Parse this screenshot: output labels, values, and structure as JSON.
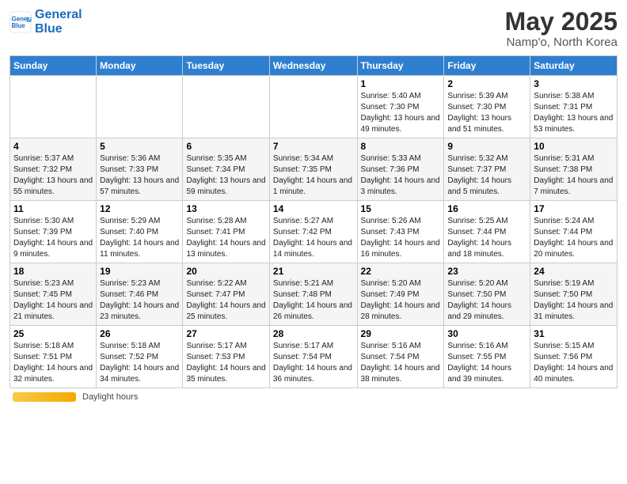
{
  "header": {
    "logo_line1": "General",
    "logo_line2": "Blue",
    "title": "May 2025",
    "subtitle": "Namp'o, North Korea"
  },
  "days_of_week": [
    "Sunday",
    "Monday",
    "Tuesday",
    "Wednesday",
    "Thursday",
    "Friday",
    "Saturday"
  ],
  "weeks": [
    [
      {
        "day": "",
        "info": ""
      },
      {
        "day": "",
        "info": ""
      },
      {
        "day": "",
        "info": ""
      },
      {
        "day": "",
        "info": ""
      },
      {
        "day": "1",
        "info": "Sunrise: 5:40 AM\nSunset: 7:30 PM\nDaylight: 13 hours and 49 minutes."
      },
      {
        "day": "2",
        "info": "Sunrise: 5:39 AM\nSunset: 7:30 PM\nDaylight: 13 hours and 51 minutes."
      },
      {
        "day": "3",
        "info": "Sunrise: 5:38 AM\nSunset: 7:31 PM\nDaylight: 13 hours and 53 minutes."
      }
    ],
    [
      {
        "day": "4",
        "info": "Sunrise: 5:37 AM\nSunset: 7:32 PM\nDaylight: 13 hours and 55 minutes."
      },
      {
        "day": "5",
        "info": "Sunrise: 5:36 AM\nSunset: 7:33 PM\nDaylight: 13 hours and 57 minutes."
      },
      {
        "day": "6",
        "info": "Sunrise: 5:35 AM\nSunset: 7:34 PM\nDaylight: 13 hours and 59 minutes."
      },
      {
        "day": "7",
        "info": "Sunrise: 5:34 AM\nSunset: 7:35 PM\nDaylight: 14 hours and 1 minute."
      },
      {
        "day": "8",
        "info": "Sunrise: 5:33 AM\nSunset: 7:36 PM\nDaylight: 14 hours and 3 minutes."
      },
      {
        "day": "9",
        "info": "Sunrise: 5:32 AM\nSunset: 7:37 PM\nDaylight: 14 hours and 5 minutes."
      },
      {
        "day": "10",
        "info": "Sunrise: 5:31 AM\nSunset: 7:38 PM\nDaylight: 14 hours and 7 minutes."
      }
    ],
    [
      {
        "day": "11",
        "info": "Sunrise: 5:30 AM\nSunset: 7:39 PM\nDaylight: 14 hours and 9 minutes."
      },
      {
        "day": "12",
        "info": "Sunrise: 5:29 AM\nSunset: 7:40 PM\nDaylight: 14 hours and 11 minutes."
      },
      {
        "day": "13",
        "info": "Sunrise: 5:28 AM\nSunset: 7:41 PM\nDaylight: 14 hours and 13 minutes."
      },
      {
        "day": "14",
        "info": "Sunrise: 5:27 AM\nSunset: 7:42 PM\nDaylight: 14 hours and 14 minutes."
      },
      {
        "day": "15",
        "info": "Sunrise: 5:26 AM\nSunset: 7:43 PM\nDaylight: 14 hours and 16 minutes."
      },
      {
        "day": "16",
        "info": "Sunrise: 5:25 AM\nSunset: 7:44 PM\nDaylight: 14 hours and 18 minutes."
      },
      {
        "day": "17",
        "info": "Sunrise: 5:24 AM\nSunset: 7:44 PM\nDaylight: 14 hours and 20 minutes."
      }
    ],
    [
      {
        "day": "18",
        "info": "Sunrise: 5:23 AM\nSunset: 7:45 PM\nDaylight: 14 hours and 21 minutes."
      },
      {
        "day": "19",
        "info": "Sunrise: 5:23 AM\nSunset: 7:46 PM\nDaylight: 14 hours and 23 minutes."
      },
      {
        "day": "20",
        "info": "Sunrise: 5:22 AM\nSunset: 7:47 PM\nDaylight: 14 hours and 25 minutes."
      },
      {
        "day": "21",
        "info": "Sunrise: 5:21 AM\nSunset: 7:48 PM\nDaylight: 14 hours and 26 minutes."
      },
      {
        "day": "22",
        "info": "Sunrise: 5:20 AM\nSunset: 7:49 PM\nDaylight: 14 hours and 28 minutes."
      },
      {
        "day": "23",
        "info": "Sunrise: 5:20 AM\nSunset: 7:50 PM\nDaylight: 14 hours and 29 minutes."
      },
      {
        "day": "24",
        "info": "Sunrise: 5:19 AM\nSunset: 7:50 PM\nDaylight: 14 hours and 31 minutes."
      }
    ],
    [
      {
        "day": "25",
        "info": "Sunrise: 5:18 AM\nSunset: 7:51 PM\nDaylight: 14 hours and 32 minutes."
      },
      {
        "day": "26",
        "info": "Sunrise: 5:18 AM\nSunset: 7:52 PM\nDaylight: 14 hours and 34 minutes."
      },
      {
        "day": "27",
        "info": "Sunrise: 5:17 AM\nSunset: 7:53 PM\nDaylight: 14 hours and 35 minutes."
      },
      {
        "day": "28",
        "info": "Sunrise: 5:17 AM\nSunset: 7:54 PM\nDaylight: 14 hours and 36 minutes."
      },
      {
        "day": "29",
        "info": "Sunrise: 5:16 AM\nSunset: 7:54 PM\nDaylight: 14 hours and 38 minutes."
      },
      {
        "day": "30",
        "info": "Sunrise: 5:16 AM\nSunset: 7:55 PM\nDaylight: 14 hours and 39 minutes."
      },
      {
        "day": "31",
        "info": "Sunrise: 5:15 AM\nSunset: 7:56 PM\nDaylight: 14 hours and 40 minutes."
      }
    ]
  ],
  "footer": {
    "label": "Daylight hours"
  }
}
